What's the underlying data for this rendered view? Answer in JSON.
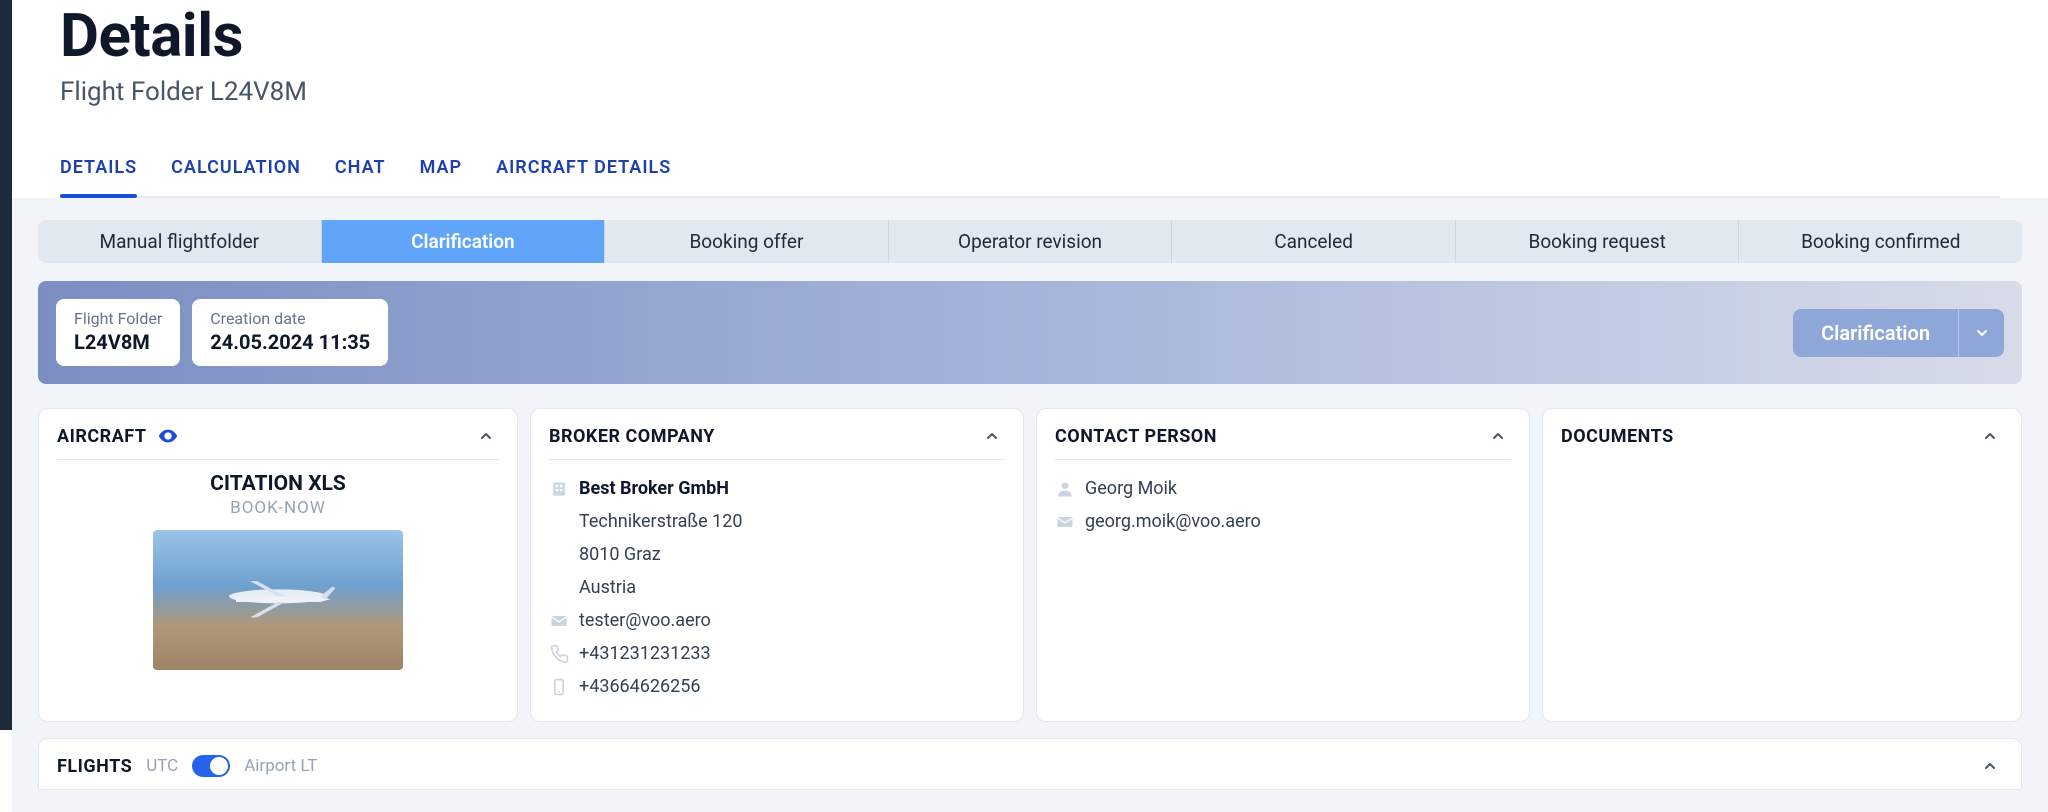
{
  "header": {
    "title": "Details",
    "subtitle": "Flight Folder L24V8M"
  },
  "nav_tabs": [
    {
      "label": "DETAILS",
      "active": true
    },
    {
      "label": "CALCULATION"
    },
    {
      "label": "CHAT"
    },
    {
      "label": "MAP"
    },
    {
      "label": "AIRCRAFT DETAILS"
    }
  ],
  "status_steps": [
    {
      "label": "Manual flightfolder"
    },
    {
      "label": "Clarification",
      "active": true
    },
    {
      "label": "Booking offer"
    },
    {
      "label": "Operator revision"
    },
    {
      "label": "Canceled"
    },
    {
      "label": "Booking request"
    },
    {
      "label": "Booking confirmed"
    }
  ],
  "info_cards": {
    "folder_label": "Flight Folder",
    "folder_value": "L24V8M",
    "created_label": "Creation date",
    "created_value": "24.05.2024 11:35"
  },
  "status_button": {
    "label": "Clarification"
  },
  "aircraft": {
    "heading": "AIRCRAFT",
    "name": "CITATION XLS",
    "subtitle": "BOOK-NOW"
  },
  "broker": {
    "heading": "BROKER COMPANY",
    "name": "Best Broker GmbH",
    "street": "Technikerstraße 120",
    "city": "8010 Graz",
    "country": "Austria",
    "email": "tester@voo.aero",
    "phone": "+431231231233",
    "mobile": "+43664626256"
  },
  "contact": {
    "heading": "CONTACT PERSON",
    "name": "Georg Moik",
    "email": "georg.moik@voo.aero"
  },
  "documents": {
    "heading": "DOCUMENTS"
  },
  "flights": {
    "heading": "FLIGHTS",
    "left_label": "UTC",
    "right_label": "Airport LT"
  }
}
